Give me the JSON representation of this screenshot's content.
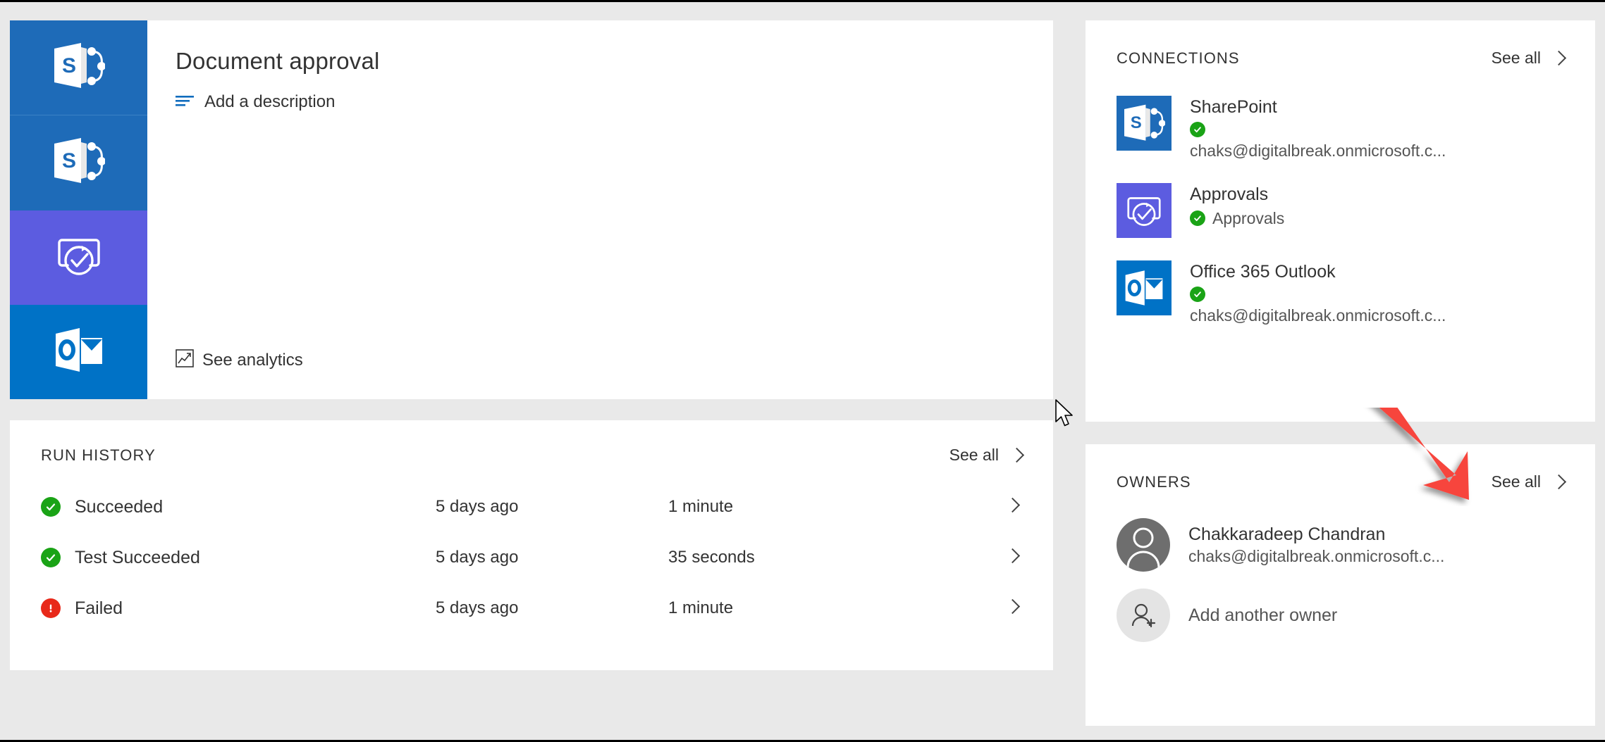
{
  "flow": {
    "title": "Document approval",
    "description_label": "Add a description",
    "analytics_label": "See analytics",
    "icons": [
      "sharepoint-icon",
      "sharepoint-icon",
      "approvals-icon",
      "outlook-icon"
    ]
  },
  "run_history": {
    "title": "RUN HISTORY",
    "see_all": "See all",
    "rows": [
      {
        "status": "Succeeded",
        "state": "ok",
        "when": "5 days ago",
        "duration": "1 minute"
      },
      {
        "status": "Test Succeeded",
        "state": "ok",
        "when": "5 days ago",
        "duration": "35 seconds"
      },
      {
        "status": "Failed",
        "state": "fail",
        "when": "5 days ago",
        "duration": "1 minute"
      }
    ]
  },
  "connections": {
    "title": "CONNECTIONS",
    "see_all": "See all",
    "items": [
      {
        "name": "SharePoint",
        "icon": "sharepoint-icon",
        "account": "chaks@digitalbreak.onmicrosoft.c...",
        "status": "connected",
        "account_inline": false
      },
      {
        "name": "Approvals",
        "icon": "approvals-icon",
        "account": "Approvals",
        "status": "connected",
        "account_inline": true
      },
      {
        "name": "Office 365 Outlook",
        "icon": "outlook-icon",
        "account": "chaks@digitalbreak.onmicrosoft.c...",
        "status": "connected",
        "account_inline": false
      }
    ]
  },
  "owners": {
    "title": "OWNERS",
    "see_all": "See all",
    "items": [
      {
        "name": "Chakkaradeep Chandran",
        "email": "chaks@digitalbreak.onmicrosoft.c..."
      }
    ],
    "add_label": "Add another owner"
  },
  "colors": {
    "sharepoint_blue": "#1e6bb8",
    "approvals_purple": "#5c5ce0",
    "outlook_blue": "#0072c6",
    "success_green": "#1aa316",
    "error_red": "#e8291a",
    "annotation_red": "#f7453d",
    "page_background": "#e9e9e9",
    "card_background": "#ffffff"
  }
}
